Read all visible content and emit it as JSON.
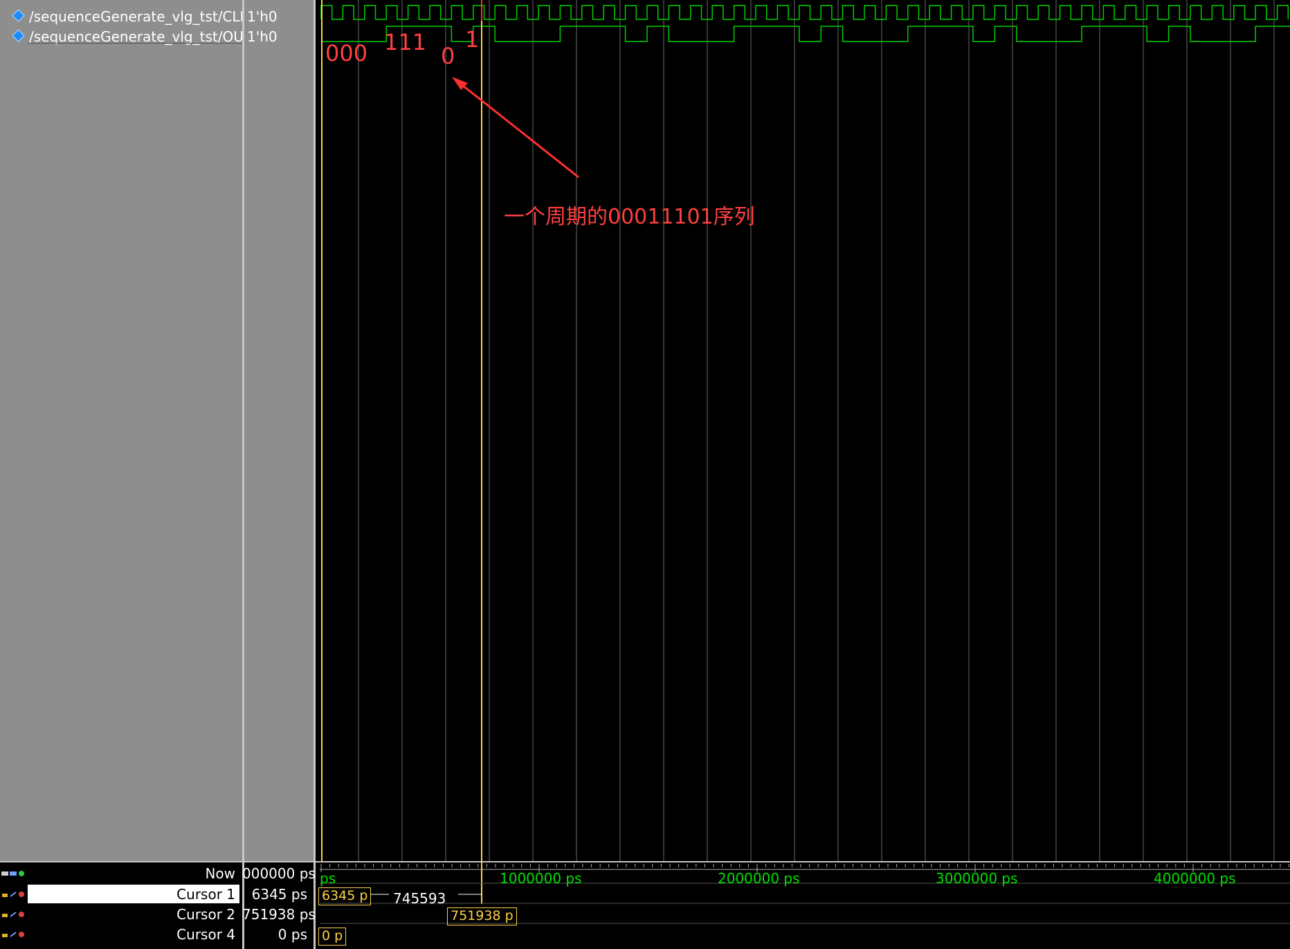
{
  "signals": [
    {
      "name": "/sequenceGenerate_vlg_tst/CLK",
      "value": "1'h0"
    },
    {
      "name": "/sequenceGenerate_vlg_tst/OUT",
      "value": "1'h0"
    }
  ],
  "annotations": {
    "bits_000": "000",
    "bits_111": "111",
    "bits_0": "0",
    "bits_1": "1",
    "note": "一个周期的00011101序列"
  },
  "footer": {
    "now_label": "Now",
    "now_value": "000000 ps",
    "cursors": [
      {
        "label": "Cursor 1",
        "value": "6345 ps",
        "tag": "6345 p"
      },
      {
        "label": "Cursor 2",
        "value": "751938 ps",
        "tag": "751938 p"
      },
      {
        "label": "Cursor 4",
        "value": "0 ps",
        "tag": "0 p"
      }
    ],
    "delta": "745593",
    "timeline_start": "ps",
    "timeline_labels": [
      "1000000 ps",
      "2000000 ps",
      "3000000 ps",
      "4000000 ps"
    ]
  },
  "colors": {
    "wave": "#00d000",
    "cursor": "#ffd24a",
    "annotation": "#ff4040",
    "panel": "#8e8e8e"
  }
}
